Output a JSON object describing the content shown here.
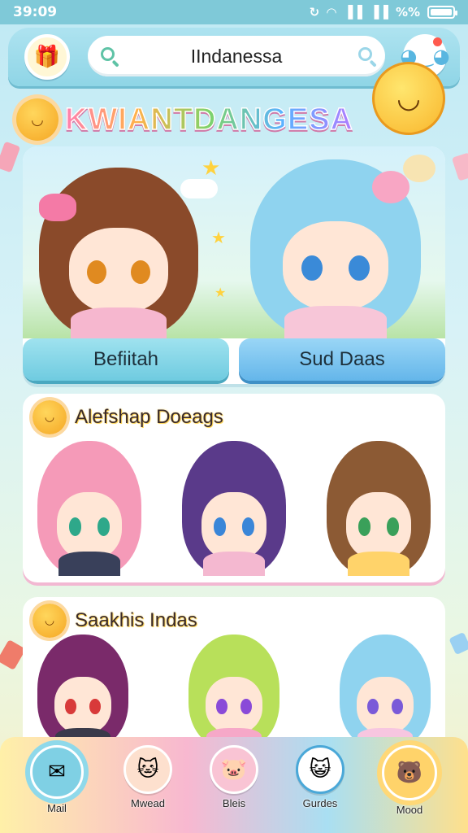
{
  "status_bar": {
    "time": "39:09",
    "right_text": "%%"
  },
  "header": {
    "search_value": "IIndanessa",
    "avatar_icon": "gift-icon",
    "notification_icon": "cat-face-icon",
    "search_icon": "search-icon"
  },
  "app_title": "KWIANTDANGESA",
  "featured": {
    "left_button": "Befiitah",
    "right_button": "Sud Daas"
  },
  "sections": [
    {
      "title": "Alefshap Doeags"
    },
    {
      "title": "Saakhis Indas"
    }
  ],
  "bottom_nav": {
    "items": [
      {
        "label": "Mail"
      },
      {
        "label": "Mwead"
      },
      {
        "label": "Bleis"
      },
      {
        "label": "Gurdes"
      },
      {
        "label": "Mood"
      }
    ]
  },
  "colors": {
    "accent": "#8fd5e6",
    "brand_pink": "#ff7fb0",
    "sun": "#f5a623"
  }
}
